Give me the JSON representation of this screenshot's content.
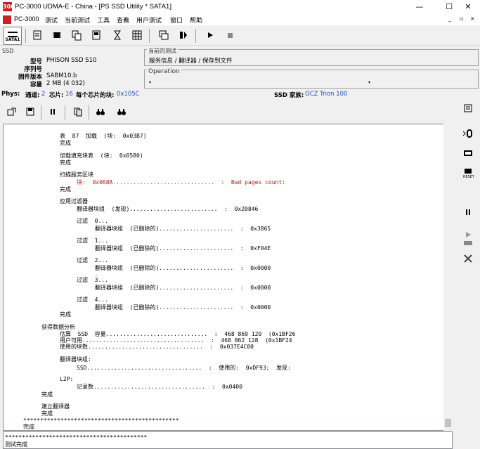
{
  "window": {
    "title": "PC-3000 UDMA-E - China - [PS SSD Utility * SATA1]",
    "app_icon_text": "3000",
    "minimize": "—",
    "maximize": "☐",
    "close": "✕"
  },
  "menu": {
    "items": [
      "PC-3000",
      "测试",
      "当前测试",
      "工具",
      "查看",
      "用户测试",
      "窗口",
      "帮助"
    ],
    "mdi_buttons": [
      "_",
      "▫",
      "×"
    ]
  },
  "toolbar": {
    "sata_label": "SATA1"
  },
  "ssd_panel": {
    "group_label": "SSD",
    "fields": [
      {
        "label": "型号",
        "value": "PHISON SSD S10"
      },
      {
        "label": "序列号",
        "value": ""
      },
      {
        "label": "固件版本",
        "value": "SABM10.b"
      },
      {
        "label": "容量",
        "value": "2 MB (4 032)"
      }
    ]
  },
  "current_test_panel": {
    "group_label": "当前的测试",
    "value": "服务信息 / 翻译器 / 保存到文件"
  },
  "operation_panel": {
    "group_label": "Operation",
    "value": ""
  },
  "status": {
    "phys_label": "Phys:",
    "channels_label": "通道:",
    "channels_value": "2",
    "chips_label": "芯片:",
    "chips_value": "16",
    "blocks_label": "每个芯片的块:",
    "blocks_value": "0x105C",
    "family_label": "SSD 家族:",
    "family_value": "OCZ Trion 100"
  },
  "log": {
    "lines": [
      {
        "indent": 80,
        "text": "表  87  加载  (块:  0x03B7)",
        "red": false
      },
      {
        "indent": 80,
        "text": "完成",
        "red": false
      },
      {
        "indent": 80,
        "text": "加载填充块表  (块:  0x0580)",
        "red": false
      },
      {
        "indent": 80,
        "text": "完成",
        "red": false
      },
      {
        "indent": 80,
        "text": "扫描服务区块",
        "red": false
      },
      {
        "indent": 104,
        "text": "块:  0x068A..............................  :  Bad pages count:",
        "red": true
      },
      {
        "indent": 80,
        "text": "完成",
        "red": false
      },
      {
        "indent": 80,
        "text": "应用过滤器",
        "red": false
      },
      {
        "indent": 104,
        "text": "翻译器块组  (发现)..........................  :  0x20846",
        "red": false
      },
      {
        "indent": 104,
        "text": "过滤  0...",
        "red": false
      },
      {
        "indent": 130,
        "text": "翻译器块组  (已删除的)......................  :  0x3865",
        "red": false
      },
      {
        "indent": 104,
        "text": "过滤  1...",
        "red": false
      },
      {
        "indent": 130,
        "text": "翻译器块组  (已删除的)......................  :  0xF04E",
        "red": false
      },
      {
        "indent": 104,
        "text": "过滤  2...",
        "red": false
      },
      {
        "indent": 130,
        "text": "翻译器块组  (已删除的)......................  :  0x0000",
        "red": false
      },
      {
        "indent": 104,
        "text": "过滤  3...",
        "red": false
      },
      {
        "indent": 130,
        "text": "翻译器块组  (已删除的)......................  :  0x0000",
        "red": false
      },
      {
        "indent": 104,
        "text": "过滤  4...",
        "red": false
      },
      {
        "indent": 130,
        "text": "翻译器块组  (已删除的)......................  :  0x0000",
        "red": false
      },
      {
        "indent": 80,
        "text": "完成",
        "red": false
      },
      {
        "indent": 54,
        "text": "获得数据分析",
        "red": false
      },
      {
        "indent": 80,
        "text": "估算  SSD  容量..............................  :  468 869 120  (0x1BF26",
        "red": false
      },
      {
        "indent": 80,
        "text": "用户可用....................................  :  468 862 128  (0x1BF24",
        "red": false
      },
      {
        "indent": 80,
        "text": "使用的块数..................................  :  0x037E4C00",
        "red": false
      },
      {
        "indent": 80,
        "text": "翻译器块组:",
        "red": false
      },
      {
        "indent": 104,
        "text": "SSD..................................  :  使用的:  0xDF93;  发现:",
        "red": false
      },
      {
        "indent": 80,
        "text": "L2P:",
        "red": false
      },
      {
        "indent": 104,
        "text": "记录数.................................  :  0x0400",
        "red": false
      },
      {
        "indent": 54,
        "text": "完成",
        "red": false
      },
      {
        "indent": 54,
        "text": "建立翻译器",
        "red": false
      },
      {
        "indent": 54,
        "text": "完成",
        "red": false
      },
      {
        "indent": 28,
        "text": "**********************************************",
        "red": false
      },
      {
        "indent": 28,
        "text": "完成",
        "red": false
      }
    ],
    "bottom_lines": [
      "******************************************",
      "测试完成"
    ]
  }
}
